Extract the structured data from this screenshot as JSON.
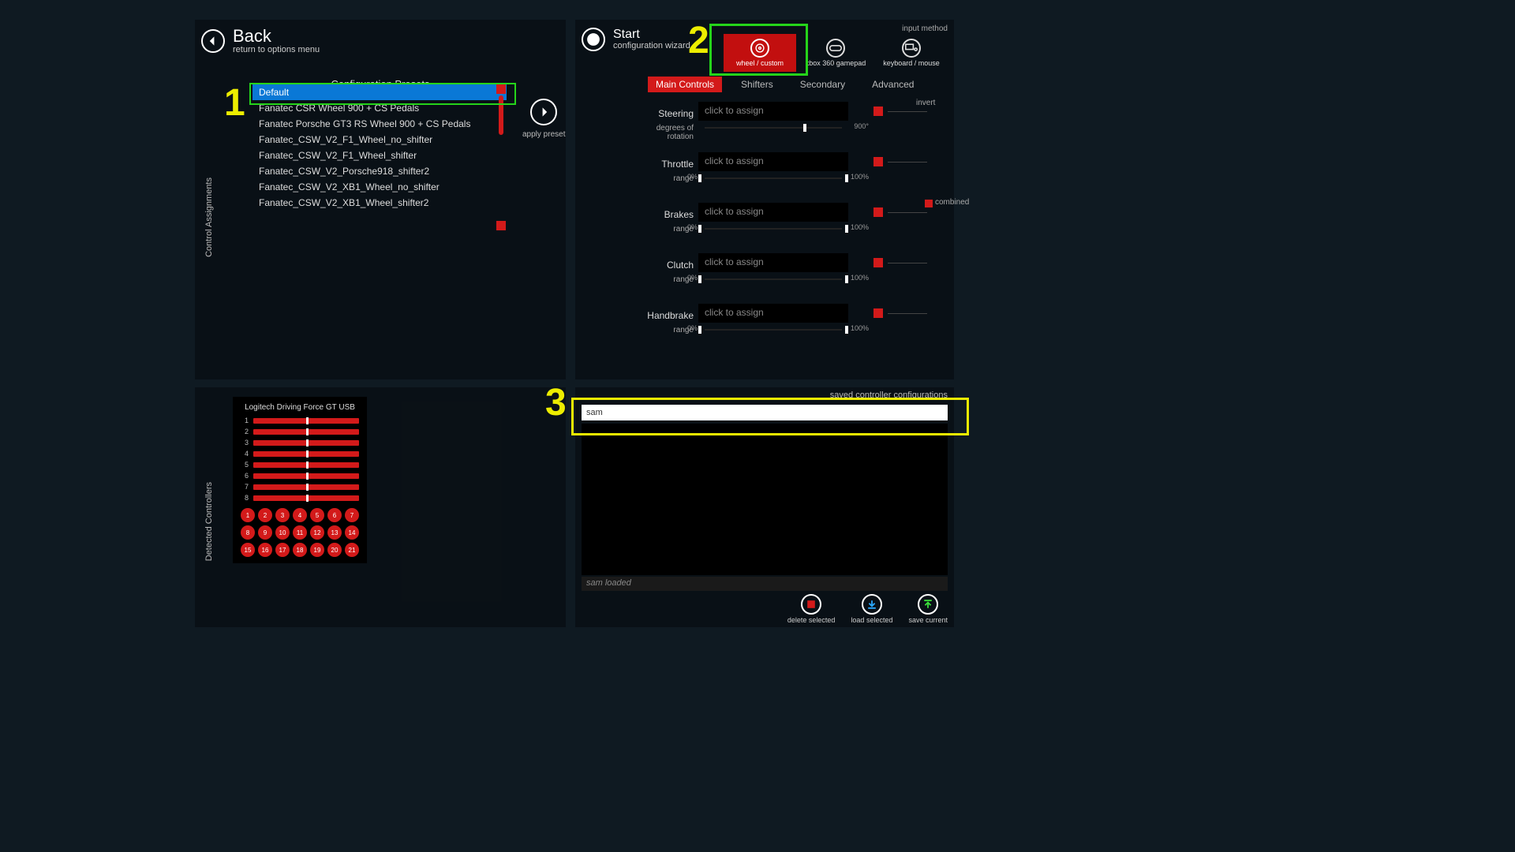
{
  "back": {
    "title": "Back",
    "subtitle": "return to options menu"
  },
  "start": {
    "title": "Start",
    "subtitle": "configuration wizard"
  },
  "presets": {
    "title": "Configuration Presets",
    "apply": "apply preset",
    "items": [
      "Default",
      "Fanatec CSR Wheel 900 + CS Pedals",
      "Fanatec Porsche GT3 RS Wheel 900 + CS Pedals",
      "Fanatec_CSW_V2_F1_Wheel_no_shifter",
      "Fanatec_CSW_V2_F1_Wheel_shifter",
      "Fanatec_CSW_V2_Porsche918_shifter2",
      "Fanatec_CSW_V2_XB1_Wheel_no_shifter",
      "Fanatec_CSW_V2_XB1_Wheel_shifter2"
    ],
    "selected_index": 0
  },
  "side_labels": {
    "control_assignments": "Control Assignments",
    "detected_controllers": "Detected Controllers"
  },
  "input_method": {
    "label": "input method",
    "items": [
      "wheel / custom",
      "xbox 360 gamepad",
      "keyboard / mouse"
    ],
    "active_index": 0
  },
  "tabs": {
    "items": [
      "Main Controls",
      "Shifters",
      "Secondary",
      "Advanced"
    ],
    "active_index": 0
  },
  "invert_label": "invert",
  "combined_label": "combined",
  "assign_placeholder": "click to assign",
  "controls": [
    {
      "name": "Steering",
      "sub": "degrees of rotation",
      "lo": "",
      "hi": "900°",
      "knob": 70
    },
    {
      "name": "Throttle",
      "sub": "range",
      "lo": "0%",
      "hi": "100%",
      "knob": 0,
      "knob2": 100
    },
    {
      "name": "Brakes",
      "sub": "range",
      "lo": "0%",
      "hi": "100%",
      "knob": 0,
      "knob2": 100
    },
    {
      "name": "Clutch",
      "sub": "range",
      "lo": "0%",
      "hi": "100%",
      "knob": 0,
      "knob2": 100
    },
    {
      "name": "Handbrake",
      "sub": "range",
      "lo": "0%",
      "hi": "100%",
      "knob": 0,
      "knob2": 100
    }
  ],
  "detected": {
    "name": "Logitech Driving Force GT USB",
    "axes": [
      1,
      2,
      3,
      4,
      5,
      6,
      7,
      8
    ],
    "buttons": [
      1,
      2,
      3,
      4,
      5,
      6,
      7,
      8,
      9,
      10,
      11,
      12,
      13,
      14,
      15,
      16,
      17,
      18,
      19,
      20,
      21
    ]
  },
  "saved": {
    "title": "saved controller configurations",
    "input_value": "sam",
    "status": "sam loaded",
    "actions": {
      "delete": "delete selected",
      "load": "load selected",
      "save": "save current"
    }
  },
  "annotations": {
    "n1": "1",
    "n2": "2",
    "n3": "3"
  }
}
